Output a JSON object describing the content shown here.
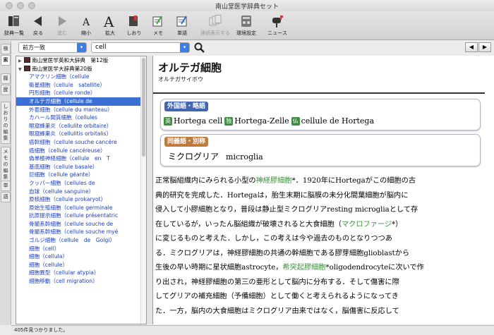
{
  "window": {
    "title": "南山堂医学辞典セット"
  },
  "toolbar": {
    "items": [
      {
        "label": "辞典一覧",
        "icon": "book-list-icon",
        "enabled": true
      },
      {
        "label": "戻る",
        "icon": "back-arrow-icon",
        "enabled": true
      },
      {
        "label": "進む",
        "icon": "forward-arrow-icon",
        "enabled": false
      },
      {
        "label": "縮小",
        "icon": "font-smaller-icon",
        "enabled": true
      },
      {
        "label": "拡大",
        "icon": "font-larger-icon",
        "enabled": true
      },
      {
        "label": "しおり",
        "icon": "bookmark-icon",
        "enabled": true
      },
      {
        "label": "メモ",
        "icon": "memo-icon",
        "enabled": true
      },
      {
        "label": "単語",
        "icon": "word-icon",
        "enabled": true
      },
      {
        "label": "連続表示する",
        "icon": "continuous-view-icon",
        "enabled": false
      },
      {
        "label": "環境設定",
        "icon": "settings-icon",
        "enabled": true
      },
      {
        "label": "ニュース",
        "icon": "news-mailbox-icon",
        "enabled": true
      }
    ]
  },
  "side_tabs": [
    {
      "label": "検",
      "active": false
    },
    {
      "label": "索",
      "active": true
    },
    {
      "label": "履",
      "active": false
    },
    {
      "label": "歴",
      "active": false
    },
    {
      "label": "しおりの編集",
      "active": false
    },
    {
      "label": "メモの編集",
      "active": false
    },
    {
      "label": "単",
      "active": false
    },
    {
      "label": "語",
      "active": false
    }
  ],
  "search": {
    "mode": "前方一致",
    "query": "cell"
  },
  "nav": {
    "prev": "◀",
    "next": "▶"
  },
  "results": {
    "books": [
      {
        "title": "南山堂医学英和大辞典　第12版",
        "expanded": false
      },
      {
        "title": "南山堂医学大辞典第20版",
        "expanded": true
      }
    ],
    "items": [
      "アマクリン細胞（cellule",
      "衛星細胞（cellule　satellite）",
      "円形細胞（cellule ronde）",
      "オルテガ細胞（cellule de",
      "外套細胞（cellule du manteau）",
      "カハール間質細胞（cellules",
      "眼窩蜂巣炎（cellulite orbitaire）",
      "眼窩蜂巣炎（cellulitis orbitalis）",
      "癌幹細胞（cellule souche cancére",
      "癌細胞（cellule cancéreuse）",
      "偽単極神経細胞（cellule　en　T",
      "基底細胞（cellule basale）",
      "巨細胞（cellule géante）",
      "クッパー細胞（cellules de",
      "血球（cellule sanguine）",
      "原核細胞（cellule prokaryot）",
      "原始生殖細胞（cellule germinale",
      "抗原提示細胞（cellule présentatric",
      "骨髄系幹細胞（cellule souche de",
      "骨髄系幹細胞（cellule souche myé",
      "ゴルジ細胞（cellule　de　Golgi）",
      "細胞（cell）",
      "細胞（cellula）",
      "細胞（cellule）",
      "細胞異型（cellular atypia）",
      "細胞移動（cell migration）"
    ],
    "selected_index": 3
  },
  "entry": {
    "headword": "オルテガ細胞",
    "reading": "オルテガサイボウ",
    "foreign_badge": "外国語・略語",
    "foreign": [
      {
        "lang": "英",
        "term": "Hortega cell"
      },
      {
        "lang": "独",
        "term": "Hortega-Zelle"
      },
      {
        "lang": "仏",
        "term": "cellule de Hortega"
      }
    ],
    "synonym_badge": "同義語・別称",
    "synonym_ja": "ミクログリア",
    "synonym_en": "microglia",
    "body": [
      [
        {
          "t": "正常脳組織内にみられる小型の"
        },
        {
          "t": "神経膠細胞",
          "link": true
        },
        {
          "t": "*．1920年にHortegaがこの細胞の古"
        }
      ],
      [
        {
          "t": "典的研究を完成した．Hortegaは，胎生末期に脳膜の未分化間葉細胞が脳内に"
        }
      ],
      [
        {
          "t": "侵入して小膠細胞となり，普段は静止型ミクログリアresting microgliaとして存"
        }
      ],
      [
        {
          "t": "在しているが，いったん脳組織が破壊されると大食細胞（"
        },
        {
          "t": "マクロファージ",
          "link": true
        },
        {
          "t": "*）"
        }
      ],
      [
        {
          "t": "に変じるものと考えた．しかし，この考えは今や過去のものとなりつつあ"
        }
      ],
      [
        {
          "t": "る．ミクログリアは，神経膠細胞の共通の幹細胞である膠芽細胞glioblastから"
        }
      ],
      [
        {
          "t": "生後の早い時期に星状細胞astrocyte，"
        },
        {
          "t": "希突起膠細胞",
          "link": true
        },
        {
          "t": "*oligodendrocyteに次いで作"
        }
      ],
      [
        {
          "t": "り出され，神経膠細胞の第三の亜形として脳内に分布する．そして傷害に際"
        }
      ],
      [
        {
          "t": "してグリアの補充細胞（予備細胞）として働くと考えられるようになってき"
        }
      ],
      [
        {
          "t": "た．一方，脳内の大食細胞はミクログリア由来ではなく，脳傷害に反応して"
        }
      ]
    ]
  },
  "status": {
    "text": "405件見つかりました。"
  }
}
